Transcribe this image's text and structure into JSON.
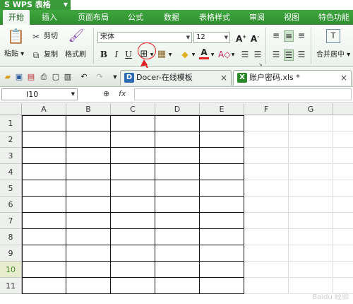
{
  "app": {
    "title": "WPS 表格"
  },
  "menu": [
    "开始",
    "插入",
    "页面布局",
    "公式",
    "数据",
    "表格样式",
    "审阅",
    "视图",
    "特色功能"
  ],
  "ribbon": {
    "paste": "粘贴",
    "cut": "剪切",
    "copy": "复制",
    "format_painter": "格式刷",
    "font_name": "宋体",
    "font_size": "12",
    "bold": "B",
    "italic": "I",
    "underline": "U",
    "merge_center": "合并居中"
  },
  "tabs": [
    {
      "label": "Docer-在线模板",
      "icon_color": "#2a6ab0"
    },
    {
      "label": "账户密码.xls *",
      "icon_color": "#2a8a2a"
    }
  ],
  "formula_bar": {
    "name_box": "I10",
    "fx": "fx",
    "formula": ""
  },
  "sheet": {
    "columns": [
      "A",
      "B",
      "C",
      "D",
      "E",
      "F",
      "G"
    ],
    "rows": [
      "1",
      "2",
      "3",
      "4",
      "5",
      "6",
      "7",
      "8",
      "9",
      "10",
      "11"
    ],
    "selected_row": "10"
  },
  "watermark": "Baidu 经验",
  "colors": {
    "accent": "#3a9a3a",
    "annotation": "#e02020"
  }
}
